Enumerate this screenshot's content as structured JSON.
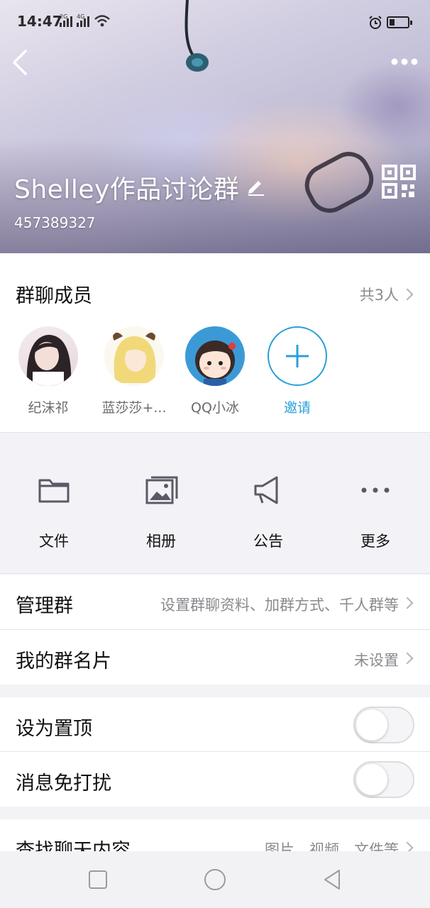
{
  "status_bar": {
    "time": "14:47",
    "signal1_label": "2G",
    "signal2_label": "4G",
    "battery_level": 0.3
  },
  "header": {
    "group_name": "Shelley作品讨论群",
    "group_id": "457389327"
  },
  "members": {
    "title": "群聊成员",
    "count": "共3人",
    "items": [
      {
        "name": "纪沫祁"
      },
      {
        "name": "蓝莎莎+..."
      },
      {
        "name": "QQ小冰"
      }
    ],
    "invite_label": "邀请"
  },
  "actions": [
    {
      "label": "文件",
      "icon": "folder-icon"
    },
    {
      "label": "相册",
      "icon": "album-icon"
    },
    {
      "label": "公告",
      "icon": "announcement-icon"
    },
    {
      "label": "更多",
      "icon": "more-dots-icon"
    }
  ],
  "rows": {
    "manage": {
      "title": "管理群",
      "value": "设置群聊资料、加群方式、千人群等"
    },
    "card": {
      "title": "我的群名片",
      "value": "未设置"
    },
    "pin": {
      "title": "设为置顶",
      "on": false
    },
    "mute": {
      "title": "消息免打扰",
      "on": false
    },
    "search": {
      "title": "查找聊天内容",
      "value": "图片、视频、文件等"
    }
  },
  "colors": {
    "accent": "#2aa0d8",
    "muted_text": "#8a8a8f"
  }
}
